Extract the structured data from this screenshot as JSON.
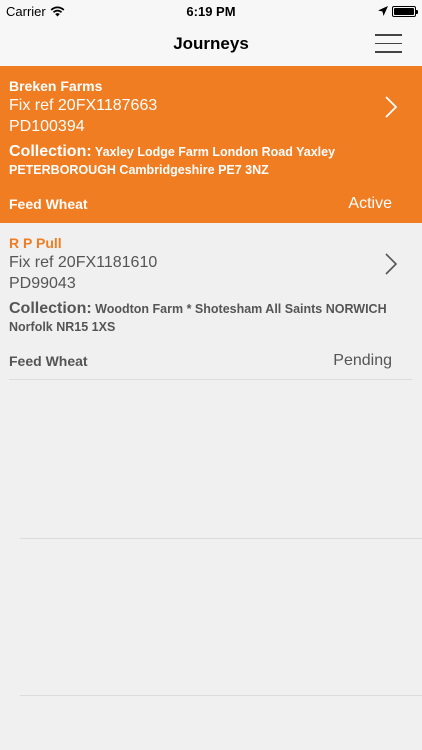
{
  "status_bar": {
    "carrier": "Carrier",
    "time": "6:19 PM"
  },
  "nav": {
    "title": "Journeys"
  },
  "journeys": [
    {
      "name": "Breken Farms",
      "fix_ref": "Fix ref 20FX1187663",
      "pd": "PD100394",
      "collection_label": "Collection:",
      "collection_address": "Yaxley Lodge Farm London Road Yaxley PETERBOROUGH Cambridgeshire PE7 3NZ",
      "product": "Feed Wheat",
      "status": "Active"
    },
    {
      "name": "R P Pull",
      "fix_ref": "Fix ref 20FX1181610",
      "pd": "PD99043",
      "collection_label": "Collection:",
      "collection_address": "Woodton Farm  *  Shotesham All Saints NORWICH Norfolk NR15 1XS",
      "product": "Feed Wheat",
      "status": "Pending"
    }
  ],
  "colors": {
    "accent": "#f07d22",
    "background": "#f0f0f1"
  },
  "icons": {
    "wifi": "wifi-icon",
    "location": "location-arrow-icon",
    "battery": "battery-icon",
    "menu": "hamburger-menu-icon",
    "chevron": "chevron-right-icon"
  }
}
